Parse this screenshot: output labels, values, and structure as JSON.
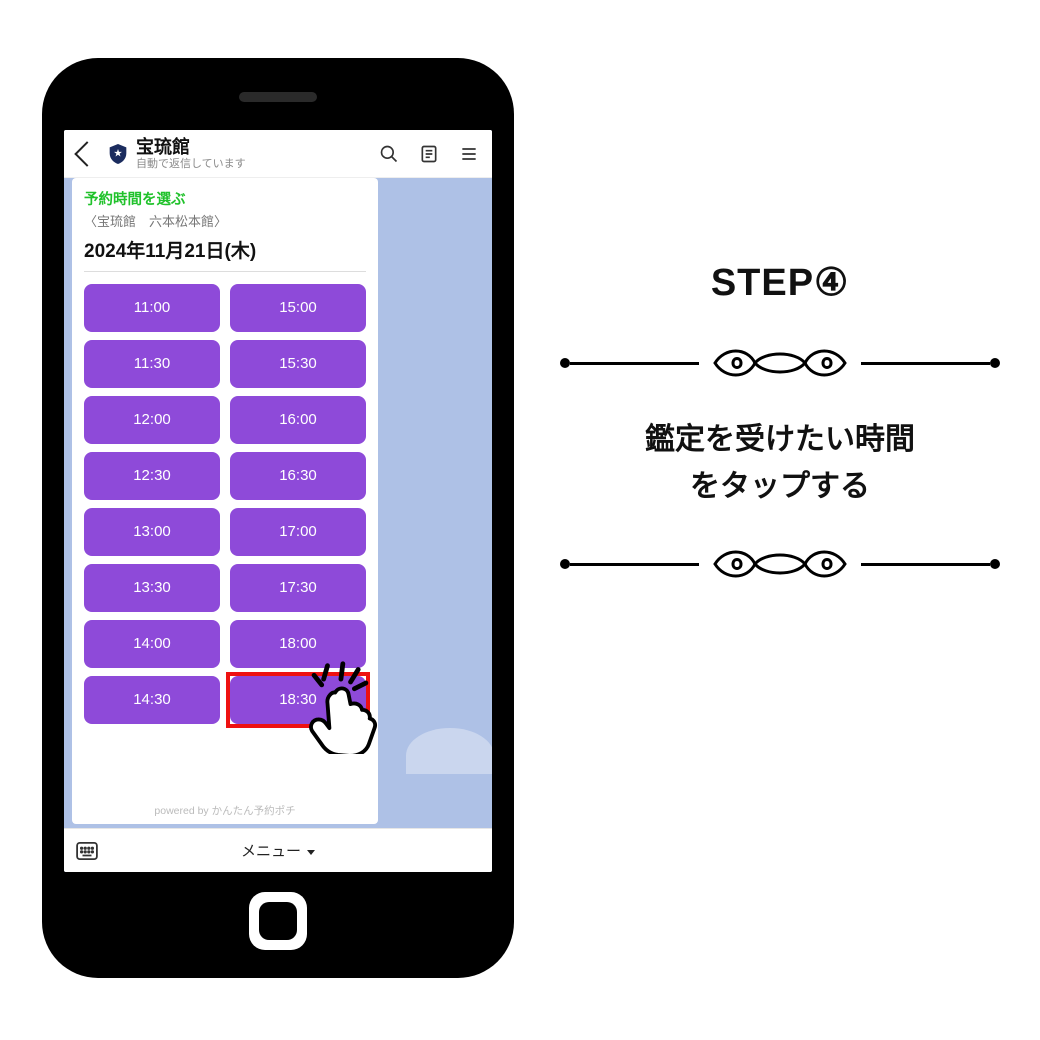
{
  "header": {
    "title": "宝琉館",
    "subtitle": "自動で返信しています"
  },
  "card": {
    "heading": "予約時間を選ぶ",
    "subheading": "〈宝琉館　六本松本館〉",
    "date": "2024年11月21日(木)",
    "powered": "powered by かんたん予約ポチ"
  },
  "times_col1": [
    "11:00",
    "11:30",
    "12:00",
    "12:30",
    "13:00",
    "13:30",
    "14:00",
    "14:30"
  ],
  "times_col2": [
    "15:00",
    "15:30",
    "16:00",
    "16:30",
    "17:00",
    "17:30",
    "18:00",
    "18:30"
  ],
  "highlighted_time": "18:30",
  "footer": {
    "menu": "メニュー"
  },
  "instructions": {
    "step": "STEP④",
    "text_line1": "鑑定を受けたい時間",
    "text_line2": "をタップする"
  }
}
